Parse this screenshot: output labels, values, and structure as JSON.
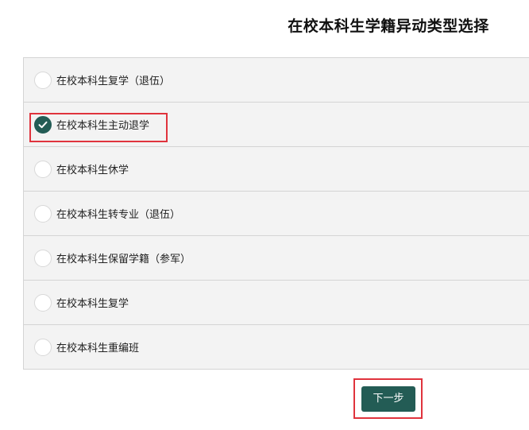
{
  "title": "在校本科生学籍异动类型选择",
  "options": [
    {
      "label": "在校本科生复学（退伍）",
      "checked": false
    },
    {
      "label": "在校本科生主动退学",
      "checked": true
    },
    {
      "label": "在校本科生休学",
      "checked": false
    },
    {
      "label": "在校本科生转专业（退伍）",
      "checked": false
    },
    {
      "label": "在校本科生保留学籍（参军）",
      "checked": false
    },
    {
      "label": "在校本科生复学",
      "checked": false
    },
    {
      "label": "在校本科生重编班",
      "checked": false
    }
  ],
  "next_button_label": "下一步",
  "colors": {
    "accent": "#235c55",
    "highlight": "#e0333d",
    "row_bg": "#f3f3f3",
    "border": "#d4d4d4"
  },
  "icons": {
    "unchecked": "radio-unchecked-icon",
    "checked": "radio-checked-icon"
  }
}
